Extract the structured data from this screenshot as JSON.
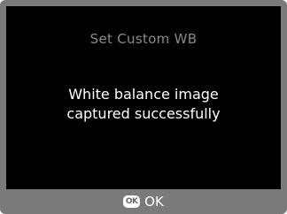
{
  "dialog": {
    "title": "Set Custom WB",
    "message_line1": "White balance image",
    "message_line2": "captured successfully"
  },
  "footer": {
    "ok_icon_text": "OK",
    "ok_label": "OK"
  },
  "colors": {
    "frame": "#7a7a7a",
    "screen": "#000000",
    "title": "#8a8a8a",
    "text": "#ffffff"
  }
}
